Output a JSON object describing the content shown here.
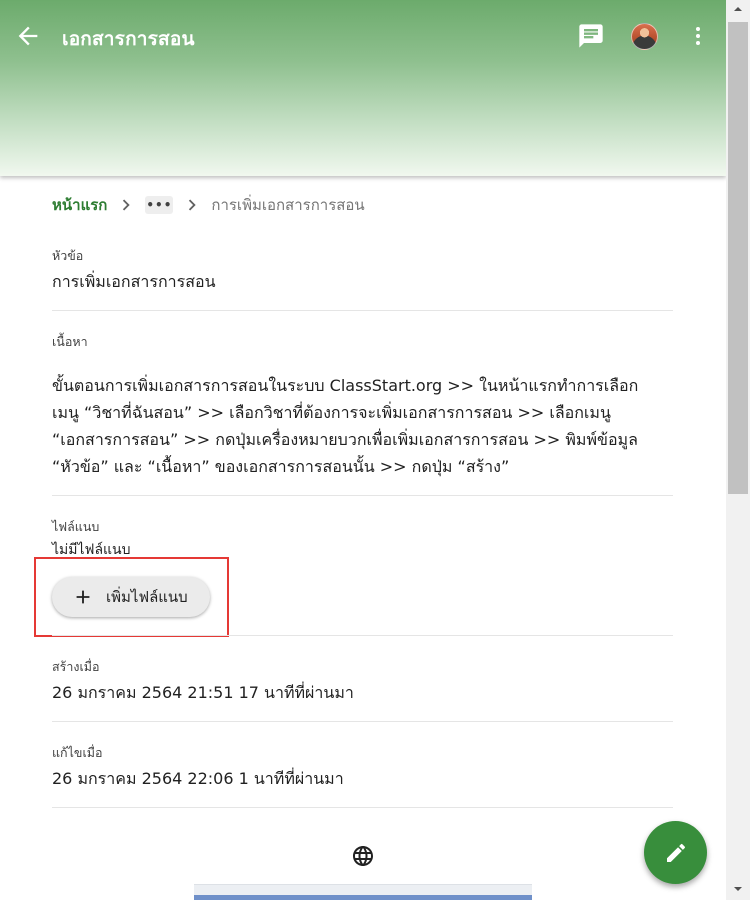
{
  "header": {
    "title": "เอกสารการสอน",
    "icons": [
      "arrow-back-icon",
      "chat-icon",
      "avatar",
      "more-vert-icon"
    ]
  },
  "breadcrumb": {
    "home": "หน้าแรก",
    "ellipsis": "•••",
    "current": "การเพิ่มเอกสารการสอน"
  },
  "topic": {
    "label": "หัวข้อ",
    "value": "การเพิ่มเอกสารการสอน"
  },
  "content": {
    "label": "เนื้อหา",
    "lines": [
      "ขั้นตอนการเพิ่มเอกสารการสอนในระบบ ClassStart.org >> ในหน้าแรกทำการเลือก",
      "เมนู “วิชาที่ฉันสอน” >> เลือกวิชาที่ต้องการจะเพิ่มเอกสารการสอน >> เลือกเมนู",
      "“เอกสารการสอน” >> กดปุ่มเครื่องหมายบวกเพื่อเพิ่มเอกสารการสอน >> พิมพ์ข้อมูล",
      "“หัวข้อ” และ “เนื้อหา” ของเอกสารการสอนนั้น >> กดปุ่ม “สร้าง”"
    ]
  },
  "attachments": {
    "label": "ไฟล์แนบ",
    "empty_text": "ไม่มีไฟล์แนบ",
    "add_button": "เพิ่มไฟล์แนบ"
  },
  "created": {
    "label": "สร้างเมื่อ",
    "value": "26 มกราคม 2564 21:51 17 นาทีที่ผ่านมา"
  },
  "modified": {
    "label": "แก้ไขเมื่อ",
    "value": "26 มกราคม 2564 22:06 1 นาทีที่ผ่านมา"
  },
  "colors": {
    "accent": "#2e7d32",
    "fab": "#388e3c",
    "highlight": "#e53935"
  }
}
